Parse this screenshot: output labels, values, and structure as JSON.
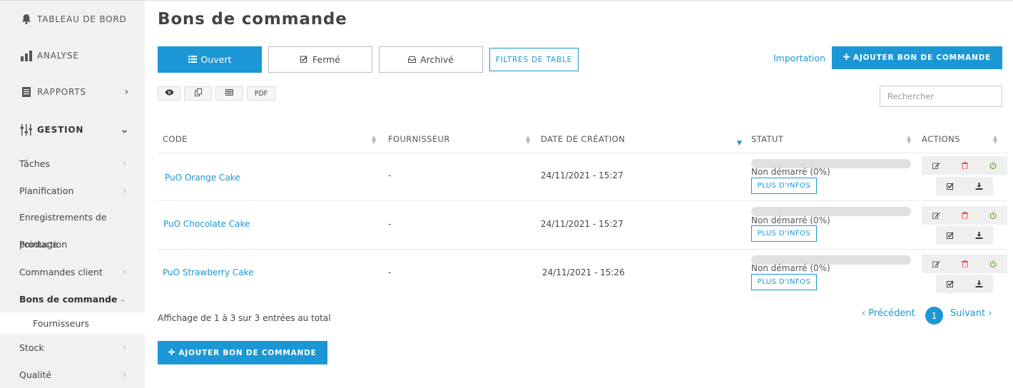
{
  "sidebar": {
    "top": [
      {
        "label": "TABLEAU DE BORD",
        "icon": "bell-icon"
      },
      {
        "label": "ANALYSE",
        "icon": "bar-chart-icon"
      },
      {
        "label": "RAPPORTS",
        "icon": "document-icon"
      },
      {
        "label": "GESTION",
        "icon": "sliders-icon"
      }
    ],
    "sub": {
      "taches": "Tâches",
      "planification": "Planification",
      "enregistrements": "Enregistrements de",
      "production": "production",
      "suivi": "Pointage",
      "commandes_client": "Commandes client",
      "bons_commande": "Bons de commande",
      "fournisseurs": "Fournisseurs",
      "stock": "Stock",
      "qualite": "Qualité"
    }
  },
  "header": {
    "title": "Bons de commande"
  },
  "tabs": {
    "ouvert": "Ouvert",
    "ferme": "Fermé",
    "archive": "Archivé"
  },
  "toolbar": {
    "filters": "FILTRES DE TABLE",
    "import": "Importation",
    "add": "AJOUTER BON DE COMMANDE",
    "pdf": "PDF",
    "search_placeholder": "Rechercher"
  },
  "table": {
    "headers": {
      "code": "CODE",
      "supplier": "FOURNISSEUR",
      "created": "DATE DE CRÉATION",
      "status": "STATUT",
      "actions": "ACTIONS"
    },
    "rows": [
      {
        "code": "PuO Orange Cake",
        "supplier": "-",
        "created": "24/11/2021 - 15:27",
        "status": "Non démarré (0%)",
        "progress": 0,
        "info": "PLUS D'INFOS"
      },
      {
        "code": "PuO Chocolate Cake",
        "supplier": "-",
        "created": "24/11/2021 - 15:27",
        "status": "Non démarré (0%)",
        "progress": 0,
        "info": "PLUS D'INFOS"
      },
      {
        "code": "PuO Strawberry Cake",
        "supplier": "-",
        "created": "24/11/2021 - 15:26",
        "status": "Non démarré (0%)",
        "progress": 0,
        "info": "PLUS D'INFOS"
      }
    ]
  },
  "footer": {
    "info": "Affichage de 1 à 3 sur 3 entrées au total",
    "prev": "‹ Précédent",
    "page": "1",
    "next": "Suivant ›",
    "add": "AJOUTER BON DE COMMANDE"
  },
  "colors": {
    "accent": "#1b97d6",
    "danger": "#e05555",
    "success": "#6aaa2b"
  }
}
